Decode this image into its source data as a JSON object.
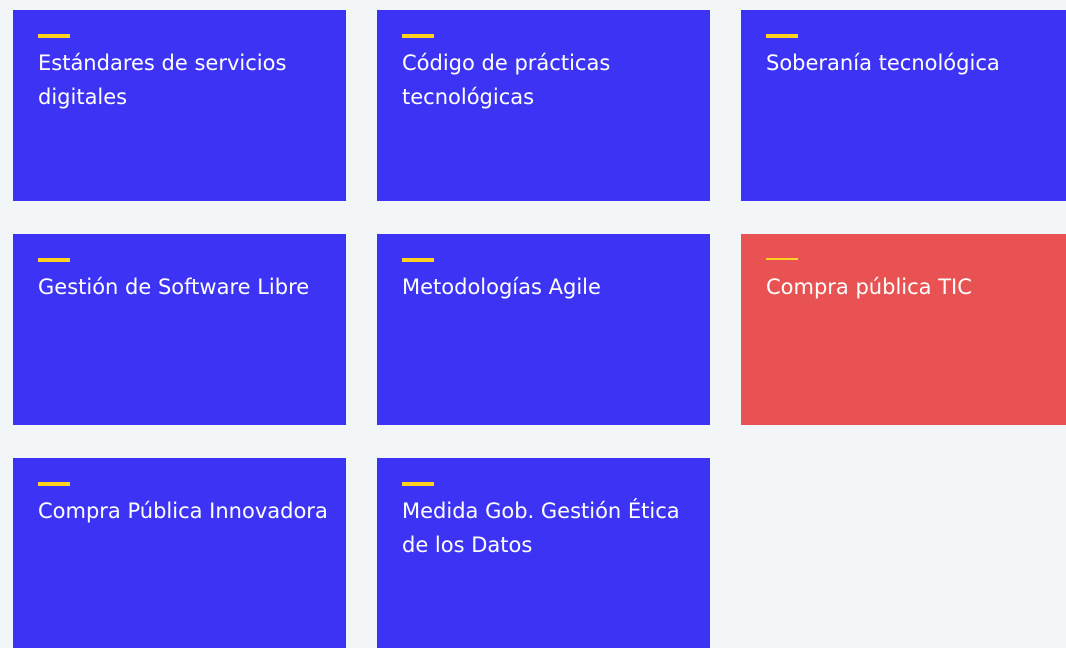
{
  "tiles": [
    {
      "title": "Estándares de servicios digitales",
      "active": false
    },
    {
      "title": "Código de prácticas tecnológicas",
      "active": false
    },
    {
      "title": "Soberanía tecnológica",
      "active": false
    },
    {
      "title": "Gestión de Software Libre",
      "active": false
    },
    {
      "title": "Metodologías Agile",
      "active": false
    },
    {
      "title": "Compra pública TIC",
      "active": true
    },
    {
      "title": "Compra Pública Innovadora",
      "active": false
    },
    {
      "title": "Medida Gob. Gestión Ética de los Datos",
      "active": false
    }
  ],
  "colors": {
    "tile": "#3c33f5",
    "tile_active": "#e85252",
    "accent": "#ffd21f",
    "background": "#f3f6f9"
  }
}
